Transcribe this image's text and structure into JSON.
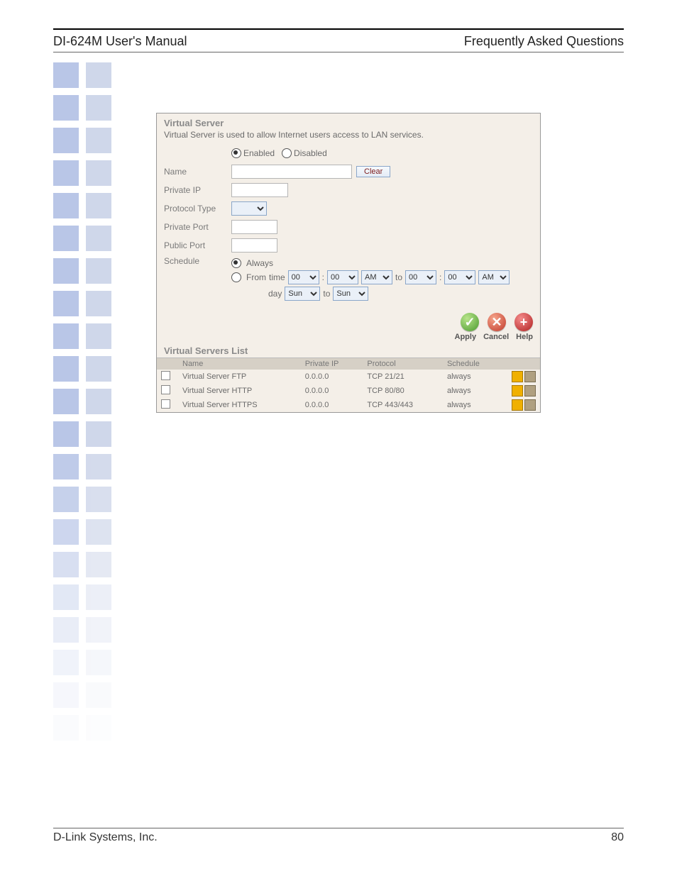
{
  "header": {
    "left": "DI-624M User's Manual",
    "right": "Frequently Asked Questions"
  },
  "panel": {
    "title": "Virtual Server",
    "description": "Virtual Server is used to allow Internet users access to LAN services.",
    "radio_enabled": "Enabled",
    "radio_disabled": "Disabled",
    "labels": {
      "name": "Name",
      "private_ip": "Private IP",
      "protocol_type": "Protocol Type",
      "private_port": "Private Port",
      "public_port": "Public Port",
      "schedule": "Schedule"
    },
    "clear_btn": "Clear",
    "schedule": {
      "opt_always": "Always",
      "opt_from": "From",
      "word_time": "time",
      "word_to": "to",
      "word_day": "day",
      "hour_a": "00",
      "min_a": "00",
      "ampm_a": "AM",
      "hour_b": "00",
      "min_b": "00",
      "ampm_b": "AM",
      "day_a": "Sun",
      "day_b": "Sun"
    },
    "actions": {
      "apply": "Apply",
      "cancel": "Cancel",
      "help": "Help"
    }
  },
  "list": {
    "title": "Virtual Servers List",
    "cols": {
      "name": "Name",
      "ip": "Private IP",
      "proto": "Protocol",
      "sched": "Schedule"
    },
    "rows": [
      {
        "name": "Virtual Server FTP",
        "ip": "0.0.0.0",
        "proto": "TCP 21/21",
        "sched": "always"
      },
      {
        "name": "Virtual Server HTTP",
        "ip": "0.0.0.0",
        "proto": "TCP 80/80",
        "sched": "always"
      },
      {
        "name": "Virtual Server HTTPS",
        "ip": "0.0.0.0",
        "proto": "TCP 443/443",
        "sched": "always"
      }
    ]
  },
  "footer": {
    "left": "D-Link Systems, Inc.",
    "right": "80"
  }
}
